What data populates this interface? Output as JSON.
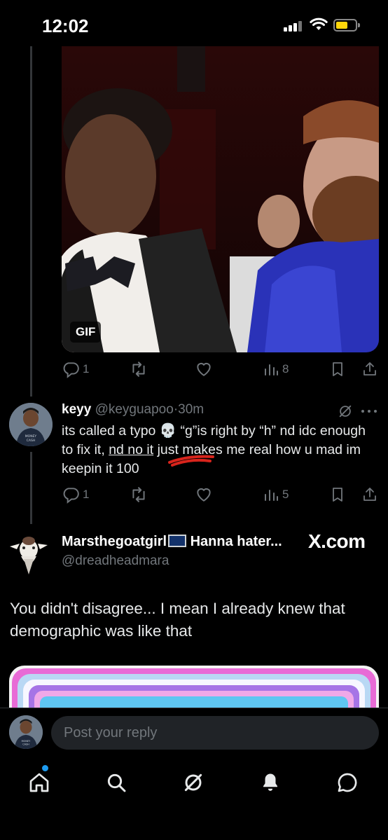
{
  "status_bar": {
    "time": "12:02"
  },
  "gif_post": {
    "badge": "GIF",
    "replies": "1",
    "views": "8"
  },
  "reply": {
    "name": "keyy",
    "handle": "@keyguapoo",
    "separator": "·",
    "time": "30m",
    "text_part1": "its called a typo ",
    "emoji": "💀",
    "text_part2": " “g”is right by “h” nd idc enough to fix it, ",
    "text_underlined": "nd no it",
    "text_part3": " just makes me real how u mad im keepin it 100",
    "replies": "1",
    "views": "5"
  },
  "main_post": {
    "name": "Marsthegoatgirl",
    "name_suffix": " Hanna hater...",
    "handle": "@dreadheadmara",
    "watermark": "X.com",
    "text": "You didn't disagree... I mean I already  knew that demographic was like that"
  },
  "composer": {
    "placeholder": "Post your reply"
  },
  "colors": {
    "background": "#000000",
    "muted": "#71767b",
    "text": "#e7e9ea",
    "accent": "#1d9bf0"
  },
  "tabs": [
    {
      "name": "home-icon"
    },
    {
      "name": "search-icon"
    },
    {
      "name": "grok-icon"
    },
    {
      "name": "notifications-icon"
    },
    {
      "name": "messages-icon"
    }
  ]
}
